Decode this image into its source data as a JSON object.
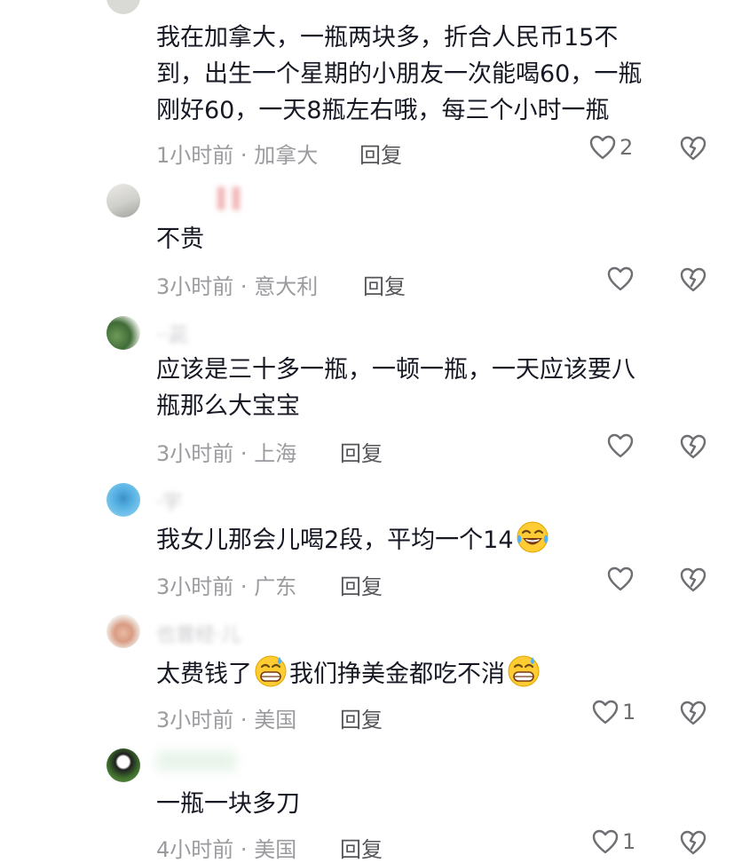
{
  "comments": [
    {
      "text_lines": [
        "我在加拿大，一瓶两块多，折合人民币15不",
        "到，出生一个星期的小朋友一次能喝60，一瓶",
        "刚好60，一天8瓶左右哦，每三个小时一瓶"
      ],
      "time": "1小时前",
      "location": "加拿大",
      "reply_label": "回复",
      "likes": "2"
    },
    {
      "username": "▌▌",
      "text_lines": [
        "不贵"
      ],
      "time": "3小时前",
      "location": "意大利",
      "reply_label": "回复",
      "likes": ""
    },
    {
      "username": "··茈",
      "text_lines": [
        "应该是三十多一瓶，一顿一瓶，一天应该要八",
        "瓶那么大宝宝"
      ],
      "time": "3小时前",
      "location": "上海",
      "reply_label": "回复",
      "likes": ""
    },
    {
      "username": "·宇",
      "text_pre": "我女儿那会儿喝2段，平均一个14",
      "emoji_1": "laughing-tears-emoji",
      "time": "3小时前",
      "location": "广东",
      "reply_label": "回复",
      "likes": ""
    },
    {
      "username": "也曾经·儿",
      "text_part1": "太费钱了",
      "text_part2": "我们挣美金都吃不消",
      "emoji_1": "sweat-grin-emoji",
      "emoji_2": "sweat-grin-emoji",
      "time": "3小时前",
      "location": "美国",
      "reply_label": "回复",
      "likes": "1"
    },
    {
      "text_lines": [
        "一瓶一块多刀"
      ],
      "time": "4小时前",
      "location": "美国",
      "reply_label": "回复",
      "likes": "1"
    }
  ],
  "meta_separator": "·",
  "colors": {
    "text": "#161823",
    "meta": "#9b9b9f",
    "reply": "#545459",
    "icon": "#6e6e73"
  }
}
